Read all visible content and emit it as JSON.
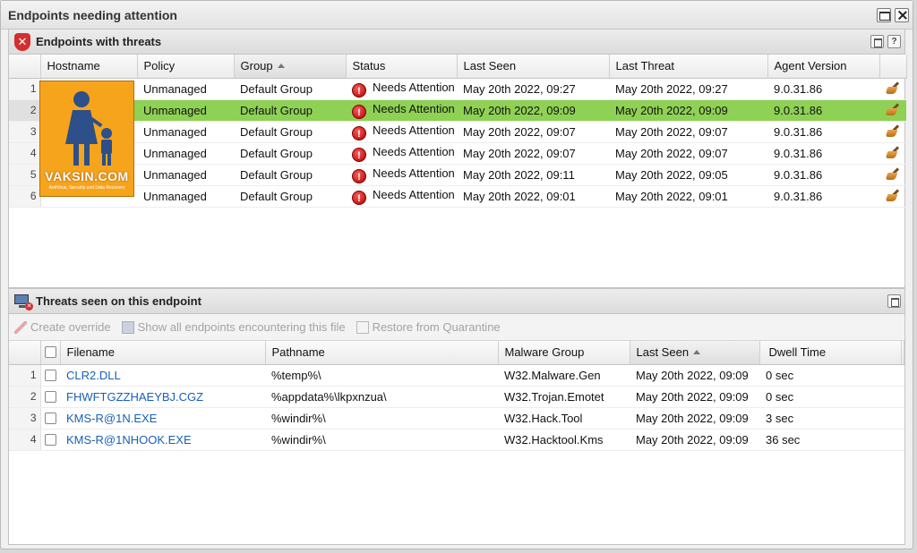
{
  "window": {
    "title": "Endpoints needing attention"
  },
  "endpoints_panel": {
    "title": "Endpoints with threats",
    "help_label": "?",
    "columns": [
      "Hostname",
      "Policy",
      "Group",
      "Status",
      "Last Seen",
      "Last Threat",
      "Agent Version"
    ],
    "rows": [
      {
        "num": "1",
        "policy": "Unmanaged",
        "group": "Default Group",
        "status": "Needs Attention",
        "last_seen": "May 20th 2022, 09:27",
        "last_threat": "May 20th 2022, 09:27",
        "agent": "9.0.31.86"
      },
      {
        "num": "2",
        "policy": "Unmanaged",
        "group": "Default Group",
        "status": "Needs Attention",
        "last_seen": "May 20th 2022, 09:09",
        "last_threat": "May 20th 2022, 09:09",
        "agent": "9.0.31.86"
      },
      {
        "num": "3",
        "policy": "Unmanaged",
        "group": "Default Group",
        "status": "Needs Attention",
        "last_seen": "May 20th 2022, 09:07",
        "last_threat": "May 20th 2022, 09:07",
        "agent": "9.0.31.86"
      },
      {
        "num": "4",
        "policy": "Unmanaged",
        "group": "Default Group",
        "status": "Needs Attention",
        "last_seen": "May 20th 2022, 09:07",
        "last_threat": "May 20th 2022, 09:07",
        "agent": "9.0.31.86"
      },
      {
        "num": "5",
        "policy": "Unmanaged",
        "group": "Default Group",
        "status": "Needs Attention",
        "last_seen": "May 20th 2022, 09:11",
        "last_threat": "May 20th 2022, 09:05",
        "agent": "9.0.31.86"
      },
      {
        "num": "6",
        "policy": "Unmanaged",
        "group": "Default Group",
        "status": "Needs Attention",
        "last_seen": "May 20th 2022, 09:01",
        "last_threat": "May 20th 2022, 09:01",
        "agent": "9.0.31.86"
      }
    ],
    "selected_row": "2",
    "status_icon": "alert-icon",
    "action_icon": "broom-icon"
  },
  "logo": {
    "text": "VAKSIN.COM",
    "subtitle": "AntiVirus, Security and Data Recovery"
  },
  "threats_panel": {
    "title": "Threats seen on this endpoint",
    "toolbar": {
      "create_override": "Create override",
      "show_all": "Show all endpoints encountering this file",
      "restore": "Restore from Quarantine"
    },
    "columns": [
      "Filename",
      "Pathname",
      "Malware Group",
      "Last Seen",
      "Dwell Time"
    ],
    "rows": [
      {
        "num": "1",
        "filename": "CLR2.DLL",
        "pathname": "%temp%\\",
        "malware": "W32.Malware.Gen",
        "last_seen": "May 20th 2022, 09:09",
        "dwell": "0 sec"
      },
      {
        "num": "2",
        "filename": "FHWFTGZZHAEYBJ.CGZ",
        "pathname": "%appdata%\\lkpxnzua\\",
        "malware": "W32.Trojan.Emotet",
        "last_seen": "May 20th 2022, 09:09",
        "dwell": "0 sec"
      },
      {
        "num": "3",
        "filename": "KMS-R@1N.EXE",
        "pathname": "%windir%\\",
        "malware": "W32.Hack.Tool",
        "last_seen": "May 20th 2022, 09:09",
        "dwell": "3 sec"
      },
      {
        "num": "4",
        "filename": "KMS-R@1NHOOK.EXE",
        "pathname": "%windir%\\",
        "malware": "W32.Hacktool.Kms",
        "last_seen": "May 20th 2022, 09:09",
        "dwell": "36 sec"
      }
    ]
  },
  "colors": {
    "selected_row": "#8fd154",
    "link": "#1a5fb4",
    "alert": "#d32f2f",
    "logo_bg": "#f6a41c"
  }
}
